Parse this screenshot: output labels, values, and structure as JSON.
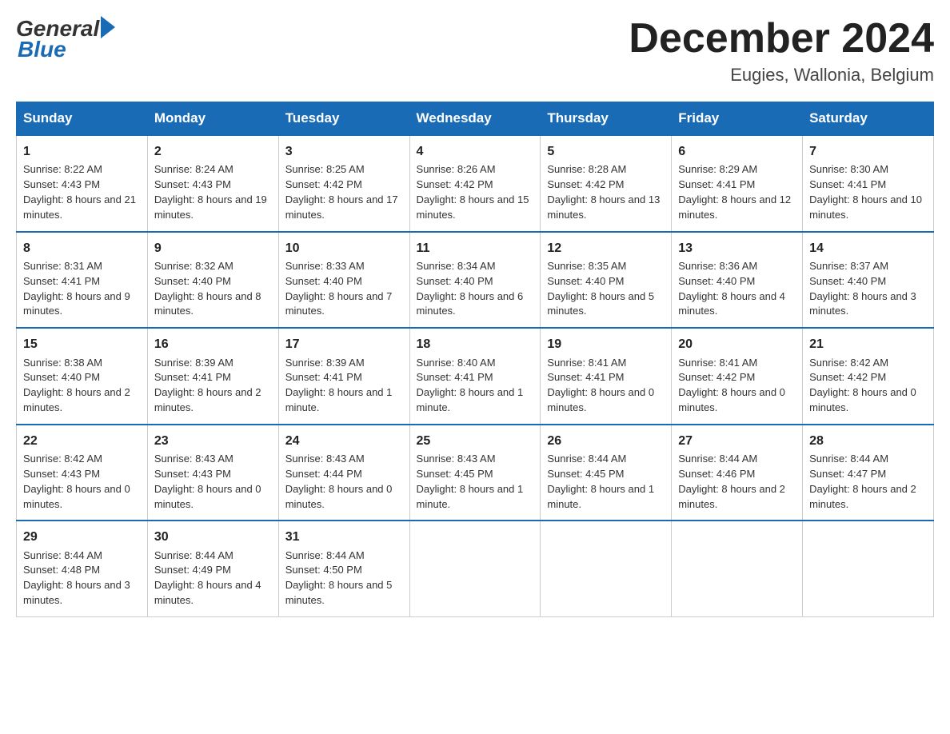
{
  "header": {
    "logo_general": "General",
    "logo_blue": "Blue",
    "month_title": "December 2024",
    "location": "Eugies, Wallonia, Belgium"
  },
  "weekdays": [
    "Sunday",
    "Monday",
    "Tuesday",
    "Wednesday",
    "Thursday",
    "Friday",
    "Saturday"
  ],
  "weeks": [
    [
      {
        "day": "1",
        "sunrise": "8:22 AM",
        "sunset": "4:43 PM",
        "daylight": "8 hours and 21 minutes."
      },
      {
        "day": "2",
        "sunrise": "8:24 AM",
        "sunset": "4:43 PM",
        "daylight": "8 hours and 19 minutes."
      },
      {
        "day": "3",
        "sunrise": "8:25 AM",
        "sunset": "4:42 PM",
        "daylight": "8 hours and 17 minutes."
      },
      {
        "day": "4",
        "sunrise": "8:26 AM",
        "sunset": "4:42 PM",
        "daylight": "8 hours and 15 minutes."
      },
      {
        "day": "5",
        "sunrise": "8:28 AM",
        "sunset": "4:42 PM",
        "daylight": "8 hours and 13 minutes."
      },
      {
        "day": "6",
        "sunrise": "8:29 AM",
        "sunset": "4:41 PM",
        "daylight": "8 hours and 12 minutes."
      },
      {
        "day": "7",
        "sunrise": "8:30 AM",
        "sunset": "4:41 PM",
        "daylight": "8 hours and 10 minutes."
      }
    ],
    [
      {
        "day": "8",
        "sunrise": "8:31 AM",
        "sunset": "4:41 PM",
        "daylight": "8 hours and 9 minutes."
      },
      {
        "day": "9",
        "sunrise": "8:32 AM",
        "sunset": "4:40 PM",
        "daylight": "8 hours and 8 minutes."
      },
      {
        "day": "10",
        "sunrise": "8:33 AM",
        "sunset": "4:40 PM",
        "daylight": "8 hours and 7 minutes."
      },
      {
        "day": "11",
        "sunrise": "8:34 AM",
        "sunset": "4:40 PM",
        "daylight": "8 hours and 6 minutes."
      },
      {
        "day": "12",
        "sunrise": "8:35 AM",
        "sunset": "4:40 PM",
        "daylight": "8 hours and 5 minutes."
      },
      {
        "day": "13",
        "sunrise": "8:36 AM",
        "sunset": "4:40 PM",
        "daylight": "8 hours and 4 minutes."
      },
      {
        "day": "14",
        "sunrise": "8:37 AM",
        "sunset": "4:40 PM",
        "daylight": "8 hours and 3 minutes."
      }
    ],
    [
      {
        "day": "15",
        "sunrise": "8:38 AM",
        "sunset": "4:40 PM",
        "daylight": "8 hours and 2 minutes."
      },
      {
        "day": "16",
        "sunrise": "8:39 AM",
        "sunset": "4:41 PM",
        "daylight": "8 hours and 2 minutes."
      },
      {
        "day": "17",
        "sunrise": "8:39 AM",
        "sunset": "4:41 PM",
        "daylight": "8 hours and 1 minute."
      },
      {
        "day": "18",
        "sunrise": "8:40 AM",
        "sunset": "4:41 PM",
        "daylight": "8 hours and 1 minute."
      },
      {
        "day": "19",
        "sunrise": "8:41 AM",
        "sunset": "4:41 PM",
        "daylight": "8 hours and 0 minutes."
      },
      {
        "day": "20",
        "sunrise": "8:41 AM",
        "sunset": "4:42 PM",
        "daylight": "8 hours and 0 minutes."
      },
      {
        "day": "21",
        "sunrise": "8:42 AM",
        "sunset": "4:42 PM",
        "daylight": "8 hours and 0 minutes."
      }
    ],
    [
      {
        "day": "22",
        "sunrise": "8:42 AM",
        "sunset": "4:43 PM",
        "daylight": "8 hours and 0 minutes."
      },
      {
        "day": "23",
        "sunrise": "8:43 AM",
        "sunset": "4:43 PM",
        "daylight": "8 hours and 0 minutes."
      },
      {
        "day": "24",
        "sunrise": "8:43 AM",
        "sunset": "4:44 PM",
        "daylight": "8 hours and 0 minutes."
      },
      {
        "day": "25",
        "sunrise": "8:43 AM",
        "sunset": "4:45 PM",
        "daylight": "8 hours and 1 minute."
      },
      {
        "day": "26",
        "sunrise": "8:44 AM",
        "sunset": "4:45 PM",
        "daylight": "8 hours and 1 minute."
      },
      {
        "day": "27",
        "sunrise": "8:44 AM",
        "sunset": "4:46 PM",
        "daylight": "8 hours and 2 minutes."
      },
      {
        "day": "28",
        "sunrise": "8:44 AM",
        "sunset": "4:47 PM",
        "daylight": "8 hours and 2 minutes."
      }
    ],
    [
      {
        "day": "29",
        "sunrise": "8:44 AM",
        "sunset": "4:48 PM",
        "daylight": "8 hours and 3 minutes."
      },
      {
        "day": "30",
        "sunrise": "8:44 AM",
        "sunset": "4:49 PM",
        "daylight": "8 hours and 4 minutes."
      },
      {
        "day": "31",
        "sunrise": "8:44 AM",
        "sunset": "4:50 PM",
        "daylight": "8 hours and 5 minutes."
      },
      null,
      null,
      null,
      null
    ]
  ]
}
